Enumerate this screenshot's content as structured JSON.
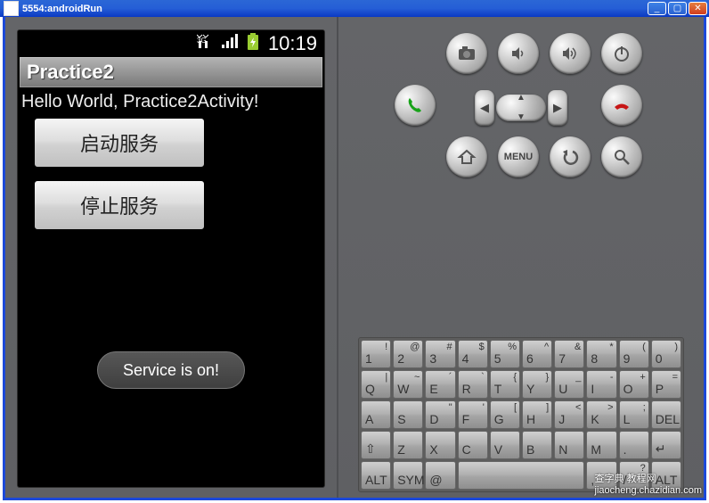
{
  "window": {
    "title": "5554:androidRun"
  },
  "statusbar": {
    "time": "10:19"
  },
  "app": {
    "title": "Practice2",
    "hello_text": "Hello World, Practice2Activity!",
    "btn_start": "启动服务",
    "btn_stop": "停止服务",
    "toast": "Service is on!"
  },
  "hw": {
    "menu": "MENU"
  },
  "keyboard": {
    "r1": [
      {
        "m": "1",
        "s": "!"
      },
      {
        "m": "2",
        "s": "@"
      },
      {
        "m": "3",
        "s": "#"
      },
      {
        "m": "4",
        "s": "$"
      },
      {
        "m": "5",
        "s": "%"
      },
      {
        "m": "6",
        "s": "^"
      },
      {
        "m": "7",
        "s": "&"
      },
      {
        "m": "8",
        "s": "*"
      },
      {
        "m": "9",
        "s": "("
      },
      {
        "m": "0",
        "s": ")"
      }
    ],
    "r2": [
      {
        "m": "Q",
        "s": "|"
      },
      {
        "m": "W",
        "s": "~"
      },
      {
        "m": "E",
        "s": "´"
      },
      {
        "m": "R",
        "s": "`"
      },
      {
        "m": "T",
        "s": "{"
      },
      {
        "m": "Y",
        "s": "}"
      },
      {
        "m": "U",
        "s": "_"
      },
      {
        "m": "I",
        "s": "-"
      },
      {
        "m": "O",
        "s": "+"
      },
      {
        "m": "P",
        "s": "="
      }
    ],
    "r3": [
      {
        "m": "A",
        "s": ""
      },
      {
        "m": "S",
        "s": ""
      },
      {
        "m": "D",
        "s": "\""
      },
      {
        "m": "F",
        "s": "'"
      },
      {
        "m": "G",
        "s": "["
      },
      {
        "m": "H",
        "s": "]"
      },
      {
        "m": "J",
        "s": "<"
      },
      {
        "m": "K",
        "s": ">"
      },
      {
        "m": "L",
        "s": ";"
      },
      {
        "m": "DEL",
        "s": ""
      }
    ],
    "r4": [
      {
        "m": "⇧",
        "s": ""
      },
      {
        "m": "Z",
        "s": ""
      },
      {
        "m": "X",
        "s": ""
      },
      {
        "m": "C",
        "s": ""
      },
      {
        "m": "V",
        "s": ""
      },
      {
        "m": "B",
        "s": ""
      },
      {
        "m": "N",
        "s": ""
      },
      {
        "m": "M",
        "s": ""
      },
      {
        "m": ".",
        "s": ""
      },
      {
        "m": "↵",
        "s": ""
      }
    ],
    "r5": {
      "alt1": "ALT",
      "sym": "SYM",
      "at": "@",
      "space": "",
      "comma": ",",
      "slash": "?",
      "alt2": "ALT"
    }
  },
  "watermark": {
    "site": "查字典 教程网",
    "url": "jiaocheng.chazidian.com"
  }
}
